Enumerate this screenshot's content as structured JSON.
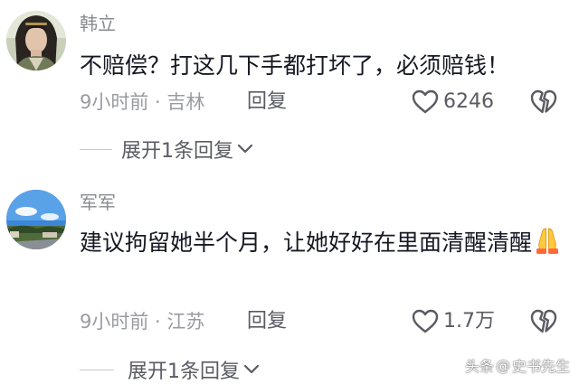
{
  "comments": [
    {
      "username": "韩立",
      "text": "不赔偿？打这几下手都打坏了，必须赔钱！",
      "time_location": "9小时前 · 吉林",
      "reply_label": "回复",
      "like_count": "6246",
      "expand_label": "展开1条回复"
    },
    {
      "username": "军军",
      "text": "建议拘留她半个月，让她好好在里面清醒清醒",
      "emoji": "folded-hands-emoji",
      "time_location": "9小时前 · 江苏",
      "reply_label": "回复",
      "like_count": "1.7万",
      "expand_label": "展开1条回复"
    }
  ],
  "watermark": {
    "prefix": "头条",
    "at": "@",
    "author": "史书先生"
  },
  "icons": {
    "like": "heart-outline-icon",
    "dislike": "broken-heart-icon",
    "expand": "chevron-down-icon"
  },
  "colors": {
    "text_primary": "#161823",
    "text_secondary": "#8a8b91",
    "meta": "#9a9ba1",
    "action": "#5a5b63"
  }
}
